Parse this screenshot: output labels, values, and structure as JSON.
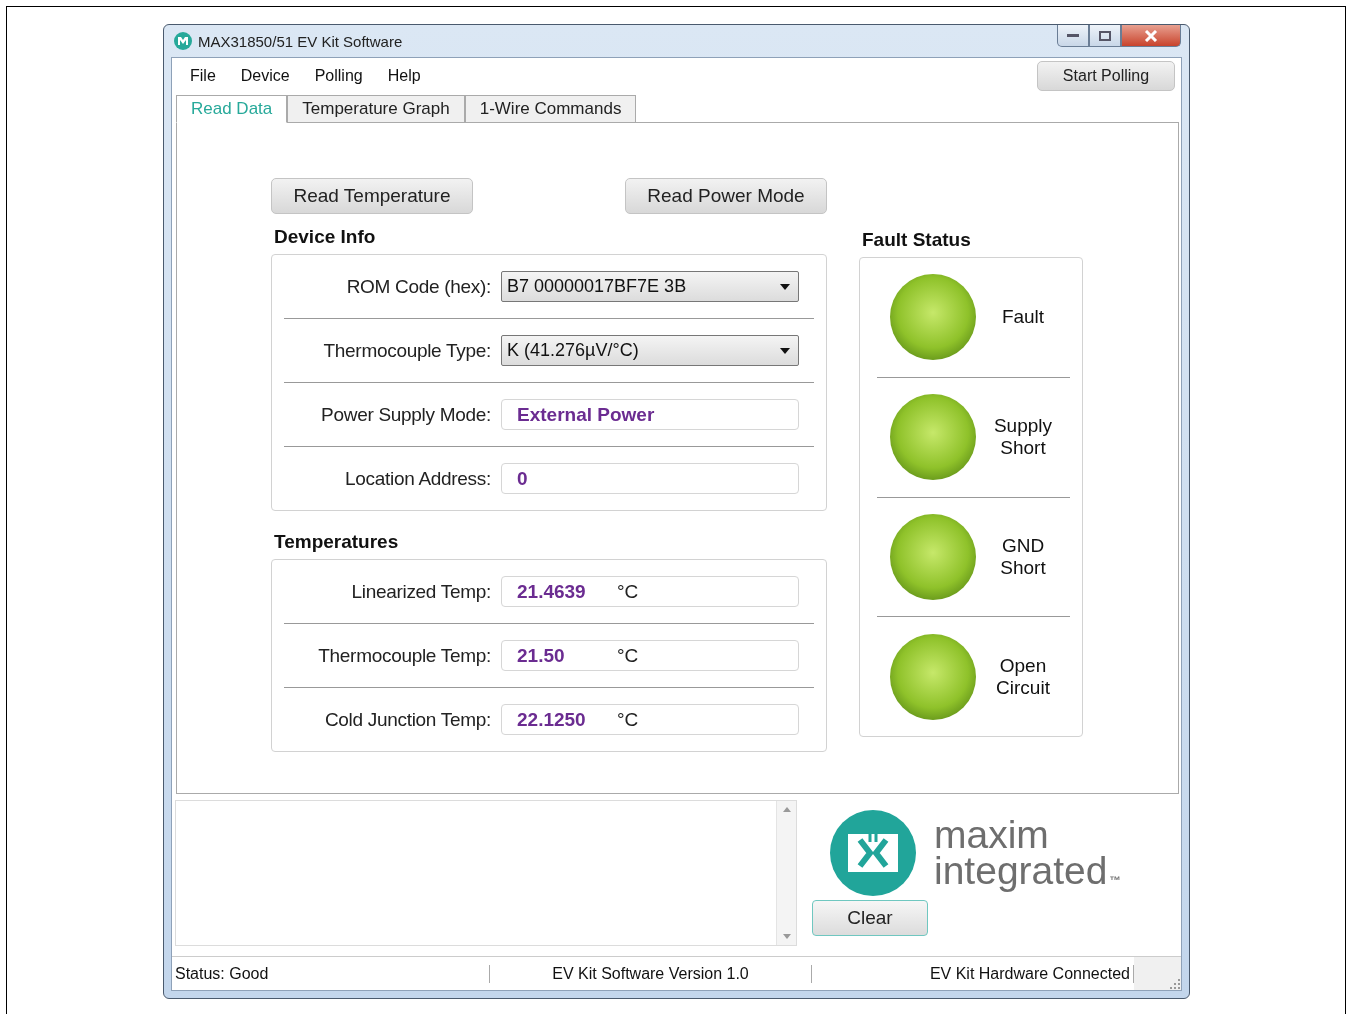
{
  "window": {
    "title": "MAX31850/51 EV Kit Software"
  },
  "menu": [
    "File",
    "Device",
    "Polling",
    "Help"
  ],
  "start_polling": "Start Polling",
  "tabs": [
    {
      "label": "Read Data",
      "selected": true
    },
    {
      "label": "Temperature Graph",
      "selected": false
    },
    {
      "label": "1-Wire Commands",
      "selected": false
    }
  ],
  "actions": [
    "Read Temperature",
    "Read Power Mode"
  ],
  "device_info": {
    "title": "Device Info",
    "rows": [
      {
        "kind": "dropdown",
        "label": "ROM Code (hex):",
        "value": "B7 00000017BF7E 3B"
      },
      {
        "kind": "dropdown",
        "label": "Thermocouple Type:",
        "value": "K (41.276µV/°C)"
      },
      {
        "kind": "readout",
        "label": "Power Supply Mode:",
        "value": "External Power"
      },
      {
        "kind": "readout",
        "label": "Location Address:",
        "value": "0"
      }
    ]
  },
  "temperatures": {
    "title": "Temperatures",
    "rows": [
      {
        "label": "Linearized Temp:",
        "value": "21.4639",
        "unit": "°C"
      },
      {
        "label": "Thermocouple Temp:",
        "value": "21.50",
        "unit": "°C"
      },
      {
        "label": "Cold Junction Temp:",
        "value": "22.1250",
        "unit": "°C"
      }
    ]
  },
  "fault_status": {
    "title": "Fault Status",
    "items": [
      {
        "label": "Fault",
        "active": false
      },
      {
        "label": "Supply Short",
        "active": false
      },
      {
        "label": "GND Short",
        "active": false
      },
      {
        "label": "Open Circuit",
        "active": false
      }
    ]
  },
  "logo": {
    "line1": "maxim",
    "line2": "integrated",
    "mark": "™"
  },
  "clear_button": "Clear",
  "status_bar": [
    "Status: Good",
    "EV Kit Software Version 1.0",
    "EV Kit Hardware Connected"
  ]
}
